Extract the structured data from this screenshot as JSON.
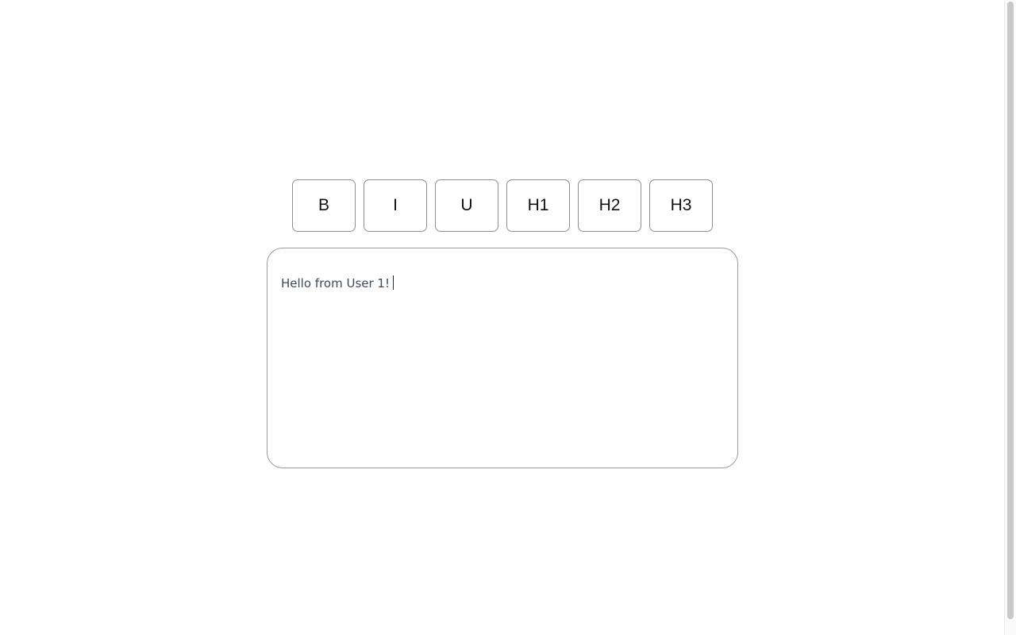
{
  "toolbar": {
    "buttons": [
      {
        "label": "B"
      },
      {
        "label": "I"
      },
      {
        "label": "U"
      },
      {
        "label": "H1"
      },
      {
        "label": "H2"
      },
      {
        "label": "H3"
      }
    ]
  },
  "editor": {
    "content": "Hello from User 1!"
  }
}
